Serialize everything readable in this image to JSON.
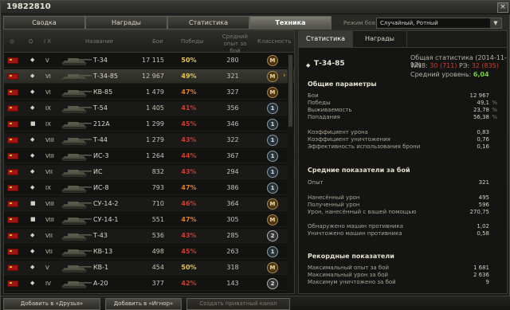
{
  "window": {
    "title": "19822810",
    "close_label": "×"
  },
  "tabs": [
    "Сводка",
    "Награды",
    "Статистика",
    "Техника"
  ],
  "mode": {
    "label": "Режим боя:",
    "value": "Случайный, Ротный"
  },
  "columns": {
    "battles": "Бои",
    "name": "Название",
    "wins": "Победы",
    "exp_line1": "Средний",
    "exp_line2": "опыт за бой",
    "mastery": "Классность",
    "tier": "I X"
  },
  "colors": {
    "wins_high": "#e9c44a",
    "wins_mid": "#e37d2a",
    "wins_low": "#d43b2b"
  },
  "rows": [
    {
      "type": "◆",
      "tier": "V",
      "name": "Т-34",
      "battles": "17 115",
      "wins": "50%",
      "wins_color": "#e9c44a",
      "exp": "280",
      "mastery": "M",
      "mastery_class": "m"
    },
    {
      "type": "◆",
      "tier": "VI",
      "name": "Т-34-85",
      "battles": "12 967",
      "wins": "49%",
      "wins_color": "#e9c44a",
      "exp": "321",
      "mastery": "M",
      "mastery_class": "m",
      "selected": true
    },
    {
      "type": "◆",
      "tier": "VI",
      "name": "КВ-85",
      "battles": "1 479",
      "wins": "47%",
      "wins_color": "#e37d2a",
      "exp": "327",
      "mastery": "M",
      "mastery_class": "m"
    },
    {
      "type": "◆",
      "tier": "IX",
      "name": "Т-54",
      "battles": "1 405",
      "wins": "41%",
      "wins_color": "#d43b2b",
      "exp": "356",
      "mastery": "1",
      "mastery_class": "b1"
    },
    {
      "type": "■",
      "tier": "IX",
      "name": "212А",
      "battles": "1 299",
      "wins": "45%",
      "wins_color": "#d43b2b",
      "exp": "346",
      "mastery": "1",
      "mastery_class": "b1"
    },
    {
      "type": "◆",
      "tier": "VIII",
      "name": "Т-44",
      "battles": "1 279",
      "wins": "43%",
      "wins_color": "#d43b2b",
      "exp": "322",
      "mastery": "1",
      "mastery_class": "b1"
    },
    {
      "type": "◆",
      "tier": "VIII",
      "name": "ИС-3",
      "battles": "1 264",
      "wins": "44%",
      "wins_color": "#d43b2b",
      "exp": "367",
      "mastery": "1",
      "mastery_class": "b1"
    },
    {
      "type": "◆",
      "tier": "VII",
      "name": "ИС",
      "battles": "832",
      "wins": "43%",
      "wins_color": "#d43b2b",
      "exp": "294",
      "mastery": "1",
      "mastery_class": "b1"
    },
    {
      "type": "◆",
      "tier": "IX",
      "name": "ИС-8",
      "battles": "793",
      "wins": "47%",
      "wins_color": "#e37d2a",
      "exp": "386",
      "mastery": "1",
      "mastery_class": "b1"
    },
    {
      "type": "■",
      "tier": "VIII",
      "name": "СУ-14-2",
      "battles": "710",
      "wins": "46%",
      "wins_color": "#d43b2b",
      "exp": "364",
      "mastery": "M",
      "mastery_class": "m"
    },
    {
      "type": "■",
      "tier": "VIII",
      "name": "СУ-14-1",
      "battles": "551",
      "wins": "47%",
      "wins_color": "#e37d2a",
      "exp": "305",
      "mastery": "M",
      "mastery_class": "m"
    },
    {
      "type": "◆",
      "tier": "VII",
      "name": "Т-43",
      "battles": "536",
      "wins": "43%",
      "wins_color": "#d43b2b",
      "exp": "285",
      "mastery": "2",
      "mastery_class": "b2"
    },
    {
      "type": "◆",
      "tier": "VII",
      "name": "КВ-13",
      "battles": "498",
      "wins": "45%",
      "wins_color": "#d43b2b",
      "exp": "263",
      "mastery": "1",
      "mastery_class": "b1"
    },
    {
      "type": "◆",
      "tier": "V",
      "name": "КВ-1",
      "battles": "454",
      "wins": "50%",
      "wins_color": "#e9c44a",
      "exp": "318",
      "mastery": "M",
      "mastery_class": "m"
    },
    {
      "type": "◆",
      "tier": "IV",
      "name": "А-20",
      "battles": "377",
      "wins": "42%",
      "wins_color": "#d43b2b",
      "exp": "143",
      "mastery": "2",
      "mastery_class": "b2"
    }
  ],
  "right": {
    "tabs": [
      "Статистика",
      "Награды"
    ],
    "tank_name": "Т-34-85",
    "general_stats": "Общая статистика (2014-11-12)",
    "wn8_label": "WN8:",
    "wn8_value": "30",
    "wn8_extra": "(711)",
    "re_label": "РЭ:",
    "re_value": "32",
    "re_extra": "(835)",
    "avg_label": "Средний уровень:",
    "avg_value": "6,04",
    "sections": {
      "general": "Общие параметры",
      "per_battle": "Средние показатели за бой",
      "records": "Рекордные показатели"
    },
    "general_rows": [
      {
        "label": "Бои",
        "value": "12 967",
        "unit": ""
      },
      {
        "label": "Победы",
        "value": "49,1",
        "unit": "%"
      },
      {
        "label": "Выживаемость",
        "value": "23,78",
        "unit": "%"
      },
      {
        "label": "Попадания",
        "value": "56,38",
        "unit": "%"
      },
      {
        "label": "Коэффициент урона",
        "value": "0,83",
        "unit": ""
      },
      {
        "label": "Коэффициент уничтожения",
        "value": "0,76",
        "unit": ""
      },
      {
        "label": "Эффективность использования брони",
        "value": "0,16",
        "unit": ""
      }
    ],
    "per_battle_rows": [
      {
        "label": "Опыт",
        "value": "321"
      },
      {
        "label": "Нанесённый урон",
        "value": "495"
      },
      {
        "label": "Полученный урон",
        "value": "596"
      },
      {
        "label": "Урон, нанесённый с вашей помощью",
        "value": "270,75"
      },
      {
        "label": "Обнаружено машин противника",
        "value": "1,02"
      },
      {
        "label": "Уничтожено машин противника",
        "value": "0,58"
      }
    ],
    "record_rows": [
      {
        "label": "Максимальный опыт за бой",
        "value": "1 681"
      },
      {
        "label": "Максимальный урон за бой",
        "value": "2 636"
      },
      {
        "label": "Максимум уничтожено за бой",
        "value": "9"
      }
    ]
  },
  "bottom": {
    "add_friends": "Добавить в «Друзья»",
    "add_ignore": "Добавить в «Игнор»",
    "create_channel": "Создать приватный канал"
  }
}
